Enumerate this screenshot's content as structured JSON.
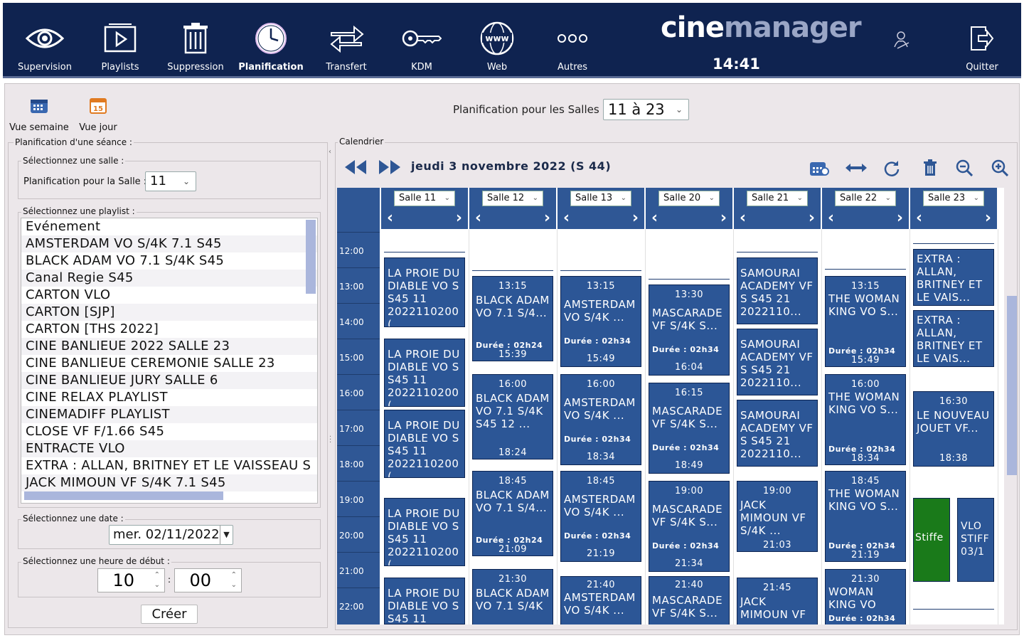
{
  "toolbar": {
    "items": [
      {
        "label": "Supervision",
        "icon": "eye-icon"
      },
      {
        "label": "Playlists",
        "icon": "play-icon"
      },
      {
        "label": "Suppression",
        "icon": "trash-icon"
      },
      {
        "label": "Planification",
        "icon": "clock-icon",
        "active": true
      },
      {
        "label": "Transfert",
        "icon": "transfer-arrows-icon"
      },
      {
        "label": "KDM",
        "icon": "key-icon"
      },
      {
        "label": "Web",
        "icon": "globe-www-icon"
      },
      {
        "label": "Autres",
        "icon": "dots-icon"
      }
    ],
    "logo_a": "cine",
    "logo_b": "manager",
    "clock": "14:41",
    "quit_label": "Quitter",
    "user_icon": "user-signature-icon"
  },
  "views": {
    "week_label": "Vue semaine",
    "day_label": "Vue jour",
    "day_icon_text": "15"
  },
  "salles": {
    "label": "Planification pour les Salles :",
    "value": "11 à 23"
  },
  "seance": {
    "title": "Planification d'une séance :",
    "salle_legend": "Sélectionnez une salle :",
    "salle_label": "Planification pour la Salle :",
    "salle_value": "11",
    "playlist_legend": "Sélectionnez une playlist :",
    "playlists": [
      "Evénement",
      "AMSTERDAM VO S/4K 7.1 S45",
      "BLACK ADAM VO 7.1 S/4K S45",
      "Canal Regie S45",
      "CARTON VLO",
      "CARTON [SJP]",
      "CARTON [THS 2022]",
      "CINE BANLIEUE 2022 SALLE 23",
      "CINE BANLIEUE CEREMONIE SALLE 23",
      "CINE BANLIEUE JURY SALLE 6",
      "CINE RELAX PLAYLIST",
      "CINEMADIFF PLAYLIST",
      "CLOSE VF F/1.66 S45",
      "ENTRACTE VLO",
      "EXTRA : ALLAN, BRITNEY ET LE VAISSEAU S",
      "JACK MIMOUN VF S/4K 7.1 S45"
    ],
    "date_legend": "Sélectionnez une date :",
    "date_value": "mer. 02/11/2022",
    "heure_legend": "Sélectionnez une heure de début :",
    "hour": "10",
    "minute": "00",
    "separator": ":",
    "create_label": "Créer"
  },
  "calendar": {
    "legend": "Calendrier",
    "date": "jeudi 3 novembre 2022 (S 44)",
    "times": [
      "12:00",
      "13:00",
      "14:00",
      "15:00",
      "16:00",
      "17:00",
      "18:00",
      "19:00",
      "20:00",
      "21:00",
      "22:00"
    ],
    "rooms": [
      "Salle 11",
      "Salle 12",
      "Salle 13",
      "Salle 20",
      "Salle 21",
      "Salle 22",
      "Salle 23"
    ],
    "events": {
      "salle11": [
        {
          "title": "LA PROIE DU DIABLE VO S S45 11 2022110200("
        },
        {
          "title": "LA PROIE DU DIABLE VO S S45 11 2022110200("
        },
        {
          "title": "LA PROIE DU DIABLE VO S S45 11 2022110200("
        },
        {
          "title": "LA PROIE DU DIABLE VO S S45 11 2022110200("
        },
        {
          "title": "LA PROIE DU DIABLE VO S S45 11"
        }
      ],
      "salle12": [
        {
          "start": "13:15",
          "title": "BLACK ADAM VO 7.1 S/4...",
          "dur": "Durée : 02h24",
          "end": "15:39"
        },
        {
          "start": "16:00",
          "title": "BLACK ADAM VO 7.1 S/4K S45 12 ...",
          "dur": "",
          "end": "18:24"
        },
        {
          "start": "18:45",
          "title": "BLACK ADAM VO 7.1 S/4...",
          "dur": "Durée : 02h24",
          "end": "21:09"
        },
        {
          "start": "21:30",
          "title": "BLACK ADAM VO 7.1 S/4K",
          "dur": "",
          "end": ""
        }
      ],
      "salle13": [
        {
          "start": "13:15",
          "title": "AMSTERDAM VO S/4K ...",
          "dur": "Durée : 02h34",
          "end": "15:49"
        },
        {
          "start": "16:00",
          "title": "AMSTERDAM VO S/4K ...",
          "dur": "Durée : 02h34",
          "end": "18:34"
        },
        {
          "start": "18:45",
          "title": "AMSTERDAM VO S/4K ...",
          "dur": "Durée : 02h34",
          "end": "21:19"
        },
        {
          "start": "21:40",
          "title": "AMSTERDAM VO S/4K ...",
          "dur": "",
          "end": ""
        }
      ],
      "salle20": [
        {
          "start": "13:30",
          "title": "MASCARADE VF S/4K S...",
          "dur": "Durée : 02h34",
          "end": "16:04"
        },
        {
          "start": "16:15",
          "title": "MASCARADE VF S/4K S...",
          "dur": "Durée : 02h34",
          "end": "18:49"
        },
        {
          "start": "19:00",
          "title": "MASCARADE VF S/4K S...",
          "dur": "Durée : 02h34",
          "end": "21:34"
        },
        {
          "start": "21:40",
          "title": "MASCARADE VF S/4K S...",
          "dur": "",
          "end": ""
        }
      ],
      "salle21": [
        {
          "title": "SAMOURAI ACADEMY VF S S45 21 2022110..."
        },
        {
          "title": "SAMOURAI ACADEMY VF S S45 21 2022110..."
        },
        {
          "title": "SAMOURAI ACADEMY VF S S45 21 2022110..."
        },
        {
          "start": "19:00",
          "title": "JACK MIMOUN VF S/4K ...",
          "end": "21:03"
        },
        {
          "start": "21:45",
          "title": "JACK MIMOUN VF",
          "end": ""
        }
      ],
      "salle22": [
        {
          "start": "13:15",
          "title": "THE WOMAN KING VO S...",
          "dur": "Durée : 02h34",
          "end": "15:49"
        },
        {
          "start": "16:00",
          "title": "THE WOMAN KING VO S...",
          "dur": "Durée : 02h34",
          "end": "18:34"
        },
        {
          "start": "18:45",
          "title": "THE WOMAN KING VO S...",
          "dur": "Durée : 02h34",
          "end": "21:19"
        },
        {
          "start": "21:30",
          "title": "WOMAN KING VO",
          "dur": "Durée : 02h34",
          "end": ""
        }
      ],
      "salle23": [
        {
          "title": "EXTRA : ALLAN, BRITNEY ET LE VAIS..."
        },
        {
          "title": "EXTRA : ALLAN, BRITNEY ET LE VAIS..."
        },
        {
          "start": "16:30",
          "title": "LE NOUVEAU JOUET VF...",
          "end": "18:38"
        },
        {
          "title": "Stiffe",
          "color": "#1a7a1a"
        },
        {
          "title": "VLO STIFF 03/1"
        }
      ]
    }
  },
  "colors": {
    "navy": "#0f2350",
    "event_blue": "#2c5696",
    "green": "#1a7a1a"
  }
}
